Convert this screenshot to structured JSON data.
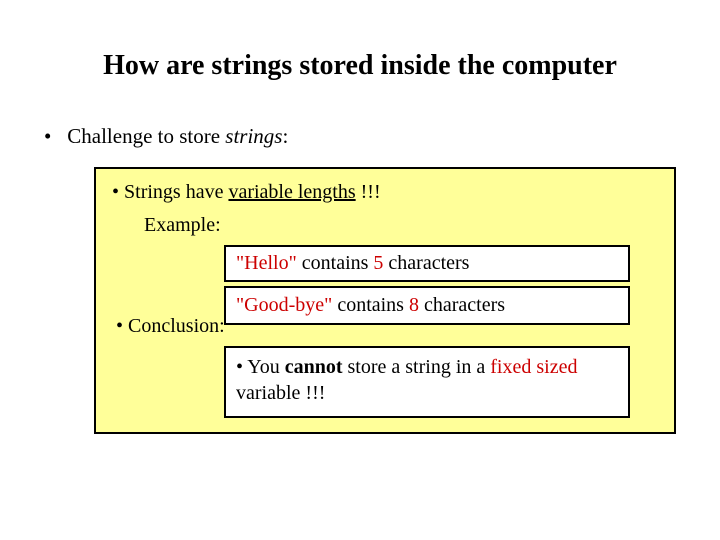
{
  "title": "How are strings stored inside the computer",
  "outer": {
    "bullet": "•",
    "challenge_prefix": "Challenge",
    "challenge_mid": " to store ",
    "challenge_strings": "strings",
    "challenge_colon": ":"
  },
  "yellow": {
    "bullet": "•",
    "line1_prefix": " Strings have ",
    "line1_var": "variable lengths",
    "line1_suffix": " !!!",
    "example_label": "Example:",
    "conclusion_bullet": "•",
    "conclusion_text": " Conclusion:"
  },
  "wb1": {
    "hello_q": "\"Hello\"",
    "contains": " contains ",
    "five": "5",
    "rest": " characters"
  },
  "wb2": {
    "goodbye_q": "\"Good-bye\"",
    "contains": " contains ",
    "eight": "8",
    "rest": " characters"
  },
  "concl": {
    "bullet": "•",
    "p1": " You ",
    "cannot": "cannot",
    "p2": " store a string in a ",
    "fixed": "fixed sized",
    "p3": " variable !!!"
  }
}
